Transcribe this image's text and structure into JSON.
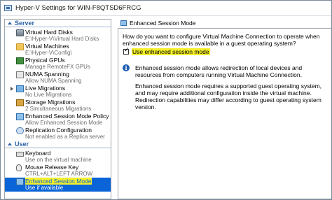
{
  "window": {
    "title": "Hyper-V Settings for WIN-F8QTSD6FRCG"
  },
  "sidebar": {
    "sections": [
      {
        "label": "Server",
        "items": [
          {
            "label": "Virtual Hard Disks",
            "sub": "E:\\Hyper-V\\Virtual Hard Disks",
            "icon": "disk-icon",
            "expander": false
          },
          {
            "label": "Virtual Machines",
            "sub": "E:\\Hyper-V\\Config\\",
            "icon": "folder-icon",
            "expander": false
          },
          {
            "label": "Physical GPUs",
            "sub": "Manage RemoteFX GPUs",
            "icon": "gpu-icon",
            "expander": false
          },
          {
            "label": "NUMA Spanning",
            "sub": "Allow NUMA Spanning",
            "icon": "numa-icon",
            "expander": false
          },
          {
            "label": "Live Migrations",
            "sub": "No Live Migrations",
            "icon": "migration-icon",
            "expander": true
          },
          {
            "label": "Storage Migrations",
            "sub": "2 Simultaneous Migrations",
            "icon": "storage-icon",
            "expander": false
          },
          {
            "label": "Enhanced Session Mode Policy",
            "sub": "Allow Enhanced Session Mode",
            "icon": "monitor-icon",
            "expander": false
          },
          {
            "label": "Replication Configuration",
            "sub": "Not enabled as a Replica server",
            "icon": "replica-icon",
            "expander": false
          }
        ]
      },
      {
        "label": "User",
        "items": [
          {
            "label": "Keyboard",
            "sub": "Use on the virtual machine",
            "icon": "keyboard-icon",
            "expander": false
          },
          {
            "label": "Mouse Release Key",
            "sub": "CTRL+ALT+LEFT ARROW",
            "icon": "mouse-icon",
            "expander": false
          },
          {
            "label": "Enhanced Session Mode",
            "sub": "Use if available",
            "icon": "monitor-icon",
            "expander": false,
            "selected": true
          }
        ]
      }
    ]
  },
  "main": {
    "header": "Enhanced Session Mode",
    "question": "How do you want to configure Virtual Machine Connection to operate when enhanced session mode is available in a guest operating system?",
    "checkbox_label": "Use enhanced session mode",
    "checkbox_checked": true,
    "info_p1": "Enhanced session mode allows redirection of local devices and resources from computers running Virtual Machine Connection.",
    "info_p2": "Enhanced session mode requires a supported guest operating system, and may require additional configuration inside the virtual machine. Redirection capabilities may differ according to guest operating system version."
  },
  "colors": {
    "selection": "#0a64d8",
    "highlight": "#f3ef2c",
    "section_header": "#2a63a6"
  }
}
